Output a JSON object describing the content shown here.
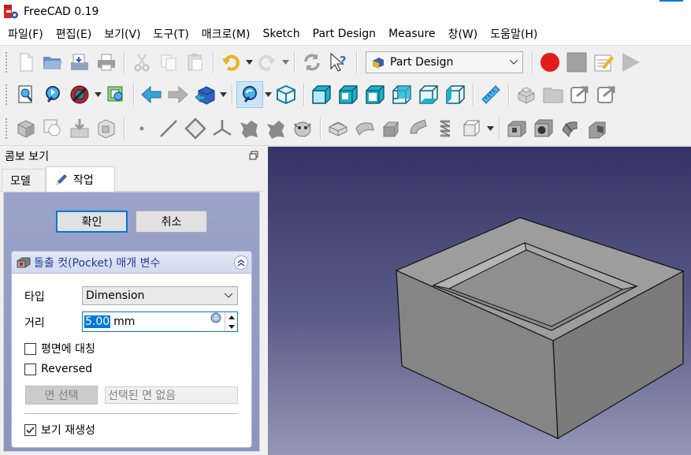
{
  "window": {
    "title": "FreeCAD 0.19",
    "logo_icon": "freecad-logo-icon"
  },
  "menu": {
    "items": [
      {
        "label": "파일(F)"
      },
      {
        "label": "편집(E)"
      },
      {
        "label": "보기(V)"
      },
      {
        "label": "도구(T)"
      },
      {
        "label": "매크로(M)"
      },
      {
        "label": "Sketch"
      },
      {
        "label": "Part Design"
      },
      {
        "label": "Measure"
      },
      {
        "label": "창(W)"
      },
      {
        "label": "도움말(H)"
      }
    ]
  },
  "toolbar": {
    "workbench": "Part Design",
    "icons_row1": [
      "new-document-icon",
      "open-folder-icon",
      "save-icon",
      "print-icon",
      "cut-icon",
      "copy-icon",
      "paste-icon",
      "undo-icon",
      "redo-icon",
      "refresh-icon",
      "whats-this-icon",
      "workbench-select",
      "record-macro-icon",
      "stop-macro-icon",
      "edit-macro-icon",
      "run-macro-icon"
    ],
    "icons_row2": [
      "fit-all-icon",
      "fit-selection-icon",
      "draw-style-icon",
      "sync-view-icon",
      "back-icon",
      "forward-icon",
      "std-views-icon",
      "view-zoom-icon",
      "view-isometric-icon",
      "view-front-icon",
      "view-top-icon",
      "view-right-icon",
      "view-rear-icon",
      "view-bottom-icon",
      "view-left-icon",
      "measure-distance-icon",
      "create-part-icon",
      "create-group-icon",
      "link-icon",
      "link-actions-icon"
    ],
    "icons_row3": [
      "body-icon",
      "clone-icon",
      "import-icon",
      "sub-shape-binder-icon",
      "datum-point-icon",
      "datum-line-icon",
      "datum-plane-icon",
      "local-cs-icon",
      "shape-binder-icon",
      "sub-binder-icon",
      "clone-shape-icon",
      "pad-icon",
      "revolve-icon",
      "additive-loft-icon",
      "additive-pipe-icon",
      "additive-helix-icon",
      "additive-primitive-icon",
      "pocket-icon",
      "hole-icon",
      "groove-icon",
      "subtractive-loft-icon"
    ]
  },
  "combo_view": {
    "title": "콤보 보기",
    "tabs": [
      {
        "label": "모델"
      },
      {
        "label": "작업"
      }
    ],
    "ok_label": "확인",
    "cancel_label": "취소",
    "params": {
      "title": "돌출 컷(Pocket) 매개 변수",
      "type_label": "타입",
      "type_value": "Dimension",
      "distance_label": "거리",
      "distance_value": "5.00",
      "distance_unit": "mm",
      "symmetric_label": "평면에 대칭",
      "symmetric_checked": false,
      "reversed_label": "Reversed",
      "reversed_checked": false,
      "face_button_label": "면 선택",
      "face_field_value": "선택된 면 없음",
      "refresh_label": "보기 재생성",
      "refresh_checked": true
    }
  },
  "colors": {
    "accent": "#0078d7",
    "viewport_top": "#353565",
    "viewport_bottom": "#9596b6",
    "model_face_top": "#9c9c9c",
    "model_face_front": "#8a8a8a",
    "model_face_side": "#7a7a7a"
  }
}
